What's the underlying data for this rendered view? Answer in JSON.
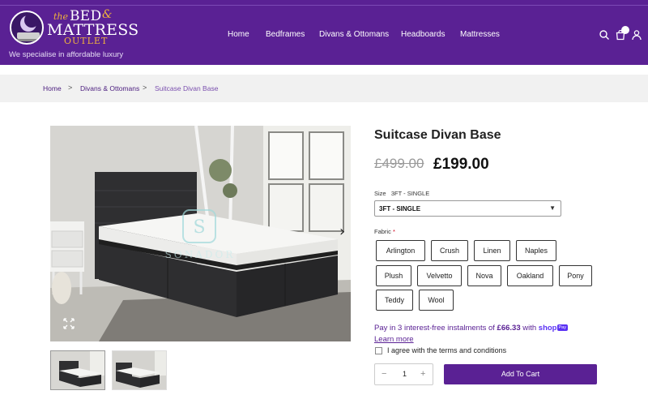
{
  "header": {
    "logo": {
      "the": "the",
      "bed": "BED",
      "amp": "&",
      "mattress": "MATTRESS",
      "outlet": "OUTLET"
    },
    "tagline": "We specialise in affordable luxury",
    "nav": [
      "Home",
      "Bedframes",
      "Divans & Ottomans",
      "Headboards",
      "Mattresses"
    ],
    "icons": [
      "search-icon",
      "shopping-bag-icon",
      "user-icon"
    ]
  },
  "breadcrumb": {
    "items": [
      "Home",
      "Divans & Ottomans",
      "Suitcase Divan Base"
    ],
    "separator": ">"
  },
  "product": {
    "title": "Suitcase Divan Base",
    "old_price": "£499.00",
    "price": "£199.00",
    "size_label": "Size",
    "size_value": "3FT - SINGLE",
    "size_selected": "3FT - SINGLE",
    "fabric_label": "Fabric",
    "fabric_required": "*",
    "fabrics": [
      "Arlington",
      "Crush",
      "Linen",
      "Naples",
      "Plush",
      "Velvetto",
      "Nova",
      "Oakland",
      "Pony",
      "Teddy",
      "Wool"
    ],
    "instalments_prefix": "Pay in 3 interest-free instalments of",
    "instalments_amount": "£66.33",
    "instalments_with": "with",
    "shop_pay": "shop",
    "shop_pay_badge": "Pay",
    "learn_more": "Learn more",
    "agree_text": "I agree with the terms and conditions",
    "quantity": "1",
    "minus": "−",
    "plus": "+",
    "add_to_cart": "Add To Cart"
  },
  "gallery": {
    "watermark": "SONADOR",
    "next_arrow": "›"
  },
  "colors": {
    "brand": "#5a2194",
    "accent": "#f0b23c",
    "shop_pay": "#5a31f4"
  }
}
